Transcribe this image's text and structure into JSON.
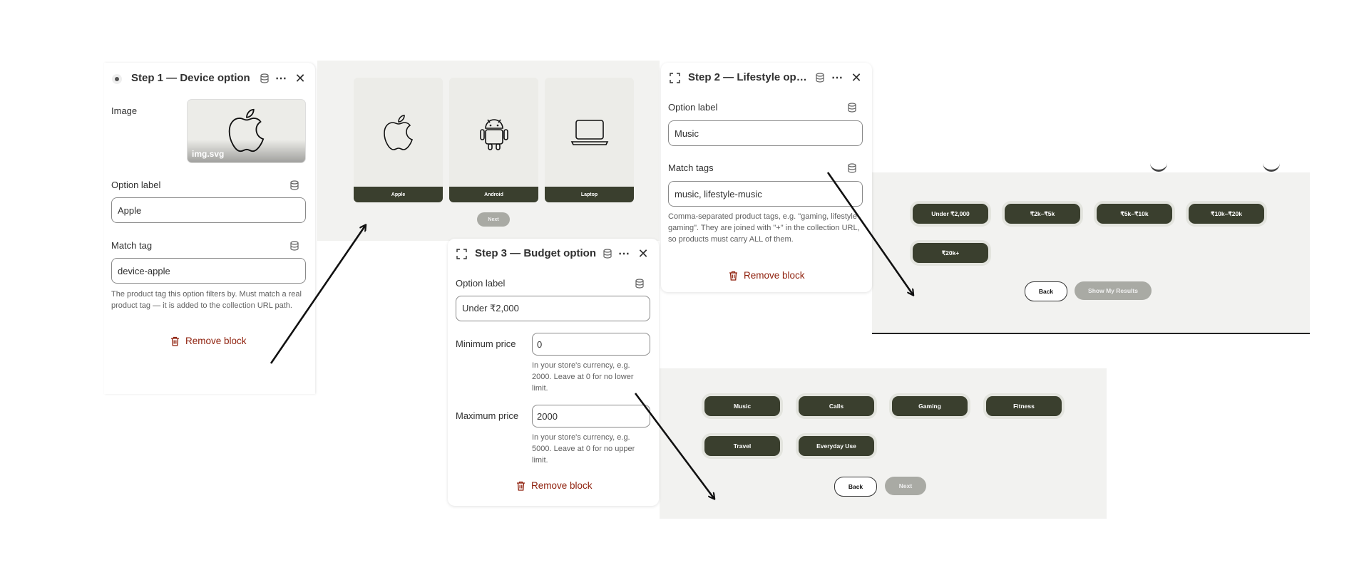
{
  "step1": {
    "title": "Step 1 — Device option",
    "image_label": "Image",
    "image_filename": "img.svg",
    "option_label_label": "Option label",
    "option_label_value": "Apple",
    "match_tag_label": "Match tag",
    "match_tag_value": "device-apple",
    "help": "The product tag this option filters by. Must match a real product tag — it is added to the collection URL path.",
    "remove": "Remove block"
  },
  "step2": {
    "title": "Step 2 — Lifestyle opti...",
    "option_label_label": "Option label",
    "option_label_value": "Music",
    "match_tags_label": "Match tags",
    "match_tags_value": "music, lifestyle-music",
    "help": "Comma-separated product tags, e.g. \"gaming, lifestyle-gaming\". They are joined with \"+\" in the collection URL, so products must carry ALL of them.",
    "remove": "Remove block"
  },
  "step3": {
    "title": "Step 3 — Budget option",
    "option_label_label": "Option label",
    "option_label_value": "Under ₹2,000",
    "min_label": "Minimum price",
    "min_value": "0",
    "min_help": "In your store's currency, e.g. 2000. Leave at 0 for no lower limit.",
    "max_label": "Maximum price",
    "max_value": "2000",
    "max_help": "In your store's currency, e.g. 5000. Leave at 0 for no upper limit.",
    "remove": "Remove block"
  },
  "device_preview": {
    "cards": [
      "Apple",
      "Android",
      "Laptop"
    ],
    "next": "Next"
  },
  "budget_preview": {
    "options": [
      "Under ₹2,000",
      "₹2k–₹5k",
      "₹5k–₹10k",
      "₹10k–₹20k",
      "₹20k+"
    ],
    "back": "Back",
    "submit": "Show My Results"
  },
  "lifestyle_preview": {
    "options": [
      "Music",
      "Calls",
      "Gaming",
      "Fitness",
      "Travel",
      "Everyday Use"
    ],
    "back": "Back",
    "next": "Next"
  },
  "colors": {
    "option_fill": "#3a3f2e",
    "remove_text": "#8e1f0b",
    "disabled_button": "#a9aaa4"
  }
}
